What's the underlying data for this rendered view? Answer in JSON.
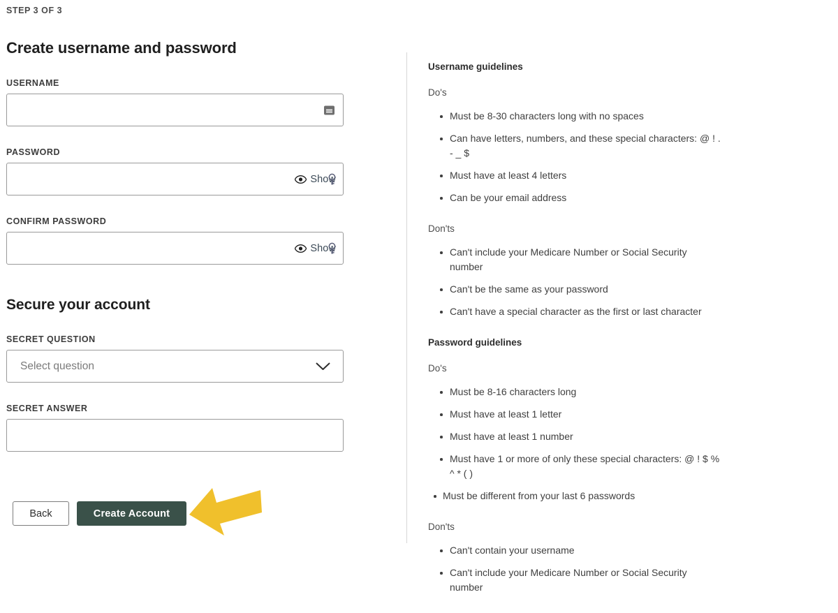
{
  "step_label": "STEP 3 OF 3",
  "page_title": "Create username and password",
  "fields": {
    "username": {
      "label": "USERNAME",
      "value": "",
      "placeholder": "",
      "icon": "autofill-keyboard-icon"
    },
    "password": {
      "label": "PASSWORD",
      "value": "",
      "placeholder": "",
      "show_label": "Show",
      "icon": "eye-icon",
      "badge_icon": "key-icon"
    },
    "confirm_password": {
      "label": "CONFIRM PASSWORD",
      "value": "",
      "placeholder": "",
      "show_label": "Show",
      "icon": "eye-icon",
      "badge_icon": "key-icon"
    },
    "secret_question": {
      "label": "SECRET QUESTION",
      "selected": "Select question",
      "icon": "chevron-down-icon"
    },
    "secret_answer": {
      "label": "SECRET ANSWER",
      "value": "",
      "placeholder": ""
    }
  },
  "secure_section_title": "Secure your account",
  "buttons": {
    "back": "Back",
    "create_account": "Create Account"
  },
  "annotation": {
    "arrow": "left-arrow-annotation",
    "color": "#f0c02c"
  },
  "colors": {
    "primary_button": "#3a5149",
    "annotation_arrow": "#f0c02c",
    "border": "#9a9a9a",
    "divider": "#d6d6d6",
    "text": "#3f3f3f"
  },
  "guidelines": [
    {
      "heading": "Username guidelines",
      "groups": [
        {
          "subheading": "Do's",
          "items": [
            "Must be 8-30 characters long with no spaces",
            "Can have letters, numbers, and these special characters: @ ! . - _ $",
            "Must have at least 4 letters",
            "Can be your email address"
          ]
        },
        {
          "subheading": "Don'ts",
          "items": [
            "Can't include your Medicare Number or Social Security number",
            "Can't be the same as your password",
            "Can't have a special character as the first or last character"
          ]
        }
      ]
    },
    {
      "heading": "Password guidelines",
      "groups": [
        {
          "subheading": "Do's",
          "items": [
            "Must be 8-16 characters long",
            "Must have at least 1 letter",
            "Must have at least 1 number",
            "Must have 1 or more of only these special characters: @ ! $ % ^ * ( )",
            "Must be different from your last 6 passwords"
          ]
        },
        {
          "subheading": "Don'ts",
          "items": [
            "Can't contain your username",
            "Can't include your Medicare Number or Social Security number"
          ]
        }
      ]
    }
  ]
}
